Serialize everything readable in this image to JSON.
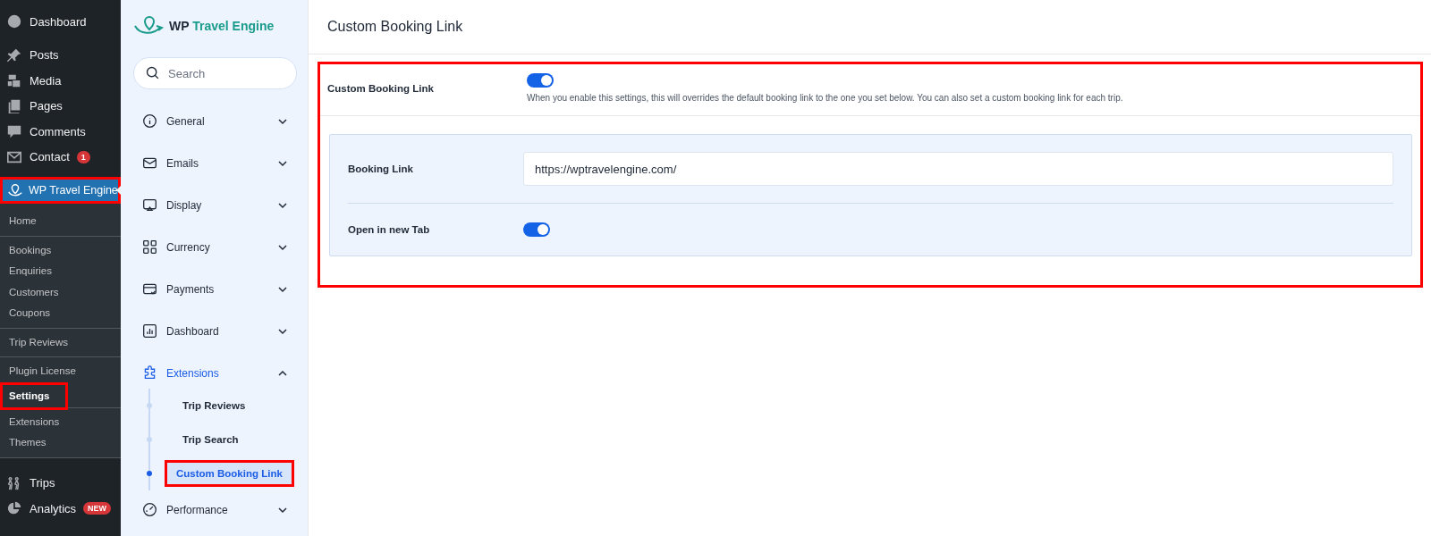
{
  "admin_menu": {
    "top": [
      {
        "label": "Dashboard"
      },
      {
        "label": "Posts"
      },
      {
        "label": "Media"
      },
      {
        "label": "Pages"
      },
      {
        "label": "Comments"
      },
      {
        "label": "Contact",
        "badge": "1"
      }
    ],
    "current": {
      "label": "WP Travel Engine",
      "highlighted": true
    },
    "submenu": [
      [
        {
          "label": "Home",
          "selected": false,
          "highlighted": false
        }
      ],
      [
        {
          "label": "Bookings",
          "selected": false,
          "highlighted": false
        },
        {
          "label": "Enquiries",
          "selected": false,
          "highlighted": false
        },
        {
          "label": "Customers",
          "selected": false,
          "highlighted": false
        },
        {
          "label": "Coupons",
          "selected": false,
          "highlighted": false
        }
      ],
      [
        {
          "label": "Trip Reviews",
          "selected": false,
          "highlighted": false
        }
      ],
      [
        {
          "label": "Plugin License",
          "selected": false,
          "highlighted": false
        },
        {
          "label": "Settings",
          "selected": true,
          "highlighted": true
        }
      ],
      [
        {
          "label": "Extensions",
          "selected": false,
          "highlighted": false
        },
        {
          "label": "Themes",
          "selected": false,
          "highlighted": false
        }
      ]
    ],
    "bottom": [
      {
        "label": "Trips"
      },
      {
        "label": "Analytics",
        "badge": "NEW"
      }
    ]
  },
  "settings_nav": {
    "brand": {
      "prefix": "WP",
      "name": "Travel Engine"
    },
    "search": {
      "placeholder": "Search"
    },
    "items": [
      {
        "label": "General",
        "expanded": false,
        "selected": false
      },
      {
        "label": "Emails",
        "expanded": false,
        "selected": false
      },
      {
        "label": "Display",
        "expanded": false,
        "selected": false
      },
      {
        "label": "Currency",
        "expanded": false,
        "selected": false
      },
      {
        "label": "Payments",
        "expanded": false,
        "selected": false
      },
      {
        "label": "Dashboard",
        "expanded": false,
        "selected": false
      },
      {
        "label": "Extensions",
        "expanded": true,
        "selected": true,
        "children": [
          {
            "label": "Trip Reviews",
            "selected": false,
            "highlighted": false
          },
          {
            "label": "Trip Search",
            "selected": false,
            "highlighted": false
          },
          {
            "label": "Custom Booking Link",
            "selected": true,
            "highlighted": true
          }
        ]
      },
      {
        "label": "Performance",
        "expanded": false,
        "selected": false
      }
    ]
  },
  "page": {
    "title": "Custom Booking Link",
    "highlighted": true,
    "enable": {
      "label": "Custom Booking Link",
      "on": true,
      "description": "When you enable this settings, this will overrides the default booking link to the one you set below. You can also set a custom booking link for each trip."
    },
    "panel": {
      "booking_link": {
        "label": "Booking Link",
        "value": "https://wptravelengine.com/"
      },
      "new_tab": {
        "label": "Open in new Tab",
        "on": true
      }
    }
  }
}
